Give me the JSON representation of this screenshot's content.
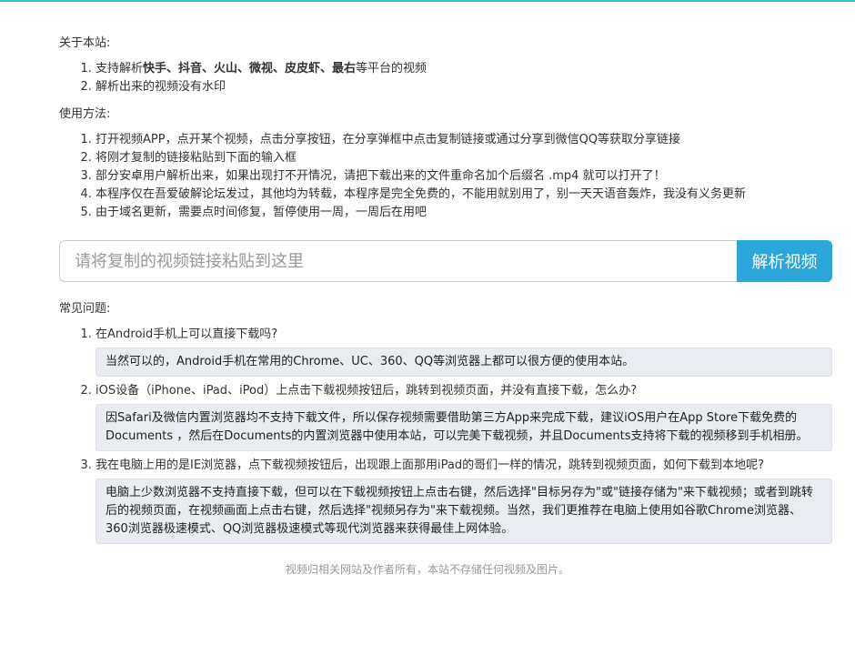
{
  "about": {
    "title": "关于本站:",
    "item1_prefix": "支持解析",
    "item1_platforms": "快手、抖音、火山、微视、皮皮虾、最右",
    "item1_suffix": "等平台的视频",
    "item2": "解析出来的视频没有水印"
  },
  "usage": {
    "title": "使用方法:",
    "items": [
      "打开视频APP，点开某个视频，点击分享按钮，在分享弹框中点击复制链接或通过分享到微信QQ等获取分享链接",
      "将刚才复制的链接粘贴到下面的输入框",
      "部分安卓用户解析出来，如果出现打不开情况，请把下载出来的文件重命名加个后缀名 .mp4 就可以打开了！",
      "本程序仅在吾爱破解论坛发过，其他均为转载，本程序是完全免费的，不能用就别用了，别一天天语音轰炸，我没有义务更新",
      "由于域名更新，需要点时间修复，暂停使用一周，一周后在用吧"
    ]
  },
  "parse": {
    "placeholder": "请将复制的视频链接粘贴到这里",
    "value": "",
    "button_label": "解析视频"
  },
  "faq": {
    "title": "常见问题:",
    "items": [
      {
        "q": "在Android手机上可以直接下载吗?",
        "a": "当然可以的，Android手机在常用的Chrome、UC、360、QQ等浏览器上都可以很方便的使用本站。"
      },
      {
        "q": "iOS设备（iPhone、iPad、iPod）上点击下载视频按钮后，跳转到视频页面，并没有直接下载，怎么办?",
        "a": "因Safari及微信内置浏览器均不支持下载文件，所以保存视频需要借助第三方App来完成下载，建议iOS用户在App Store下载免费的Documents ，然后在Documents的内置浏览器中使用本站，可以完美下载视频，并且Documents支持将下载的视频移到手机相册。"
      },
      {
        "q": "我在电脑上用的是IE浏览器，点下载视频按钮后，出现跟上面那用iPad的哥们一样的情况，跳转到视频页面，如何下载到本地呢?",
        "a": "电脑上少数浏览器不支持直接下载，但可以在下载视频按钮上点击右键，然后选择\"目标另存为\"或\"链接存储为\"来下载视频；或者到跳转后的视频页面，在视频画面上点击右键，然后选择\"视频另存为\"来下载视频。当然，我们更推荐在电脑上使用如谷歌Chrome浏览器、360浏览器极速模式、QQ浏览器极速模式等现代浏览器来获得最佳上网体验。"
      }
    ]
  },
  "footer": {
    "text": "视频归相关网站及作者所有，本站不存储任何视频及图片。"
  },
  "colors": {
    "accent": "#2aa6d9",
    "topbar": "#3ac1cf",
    "answer_bg": "#e9ecf1"
  }
}
